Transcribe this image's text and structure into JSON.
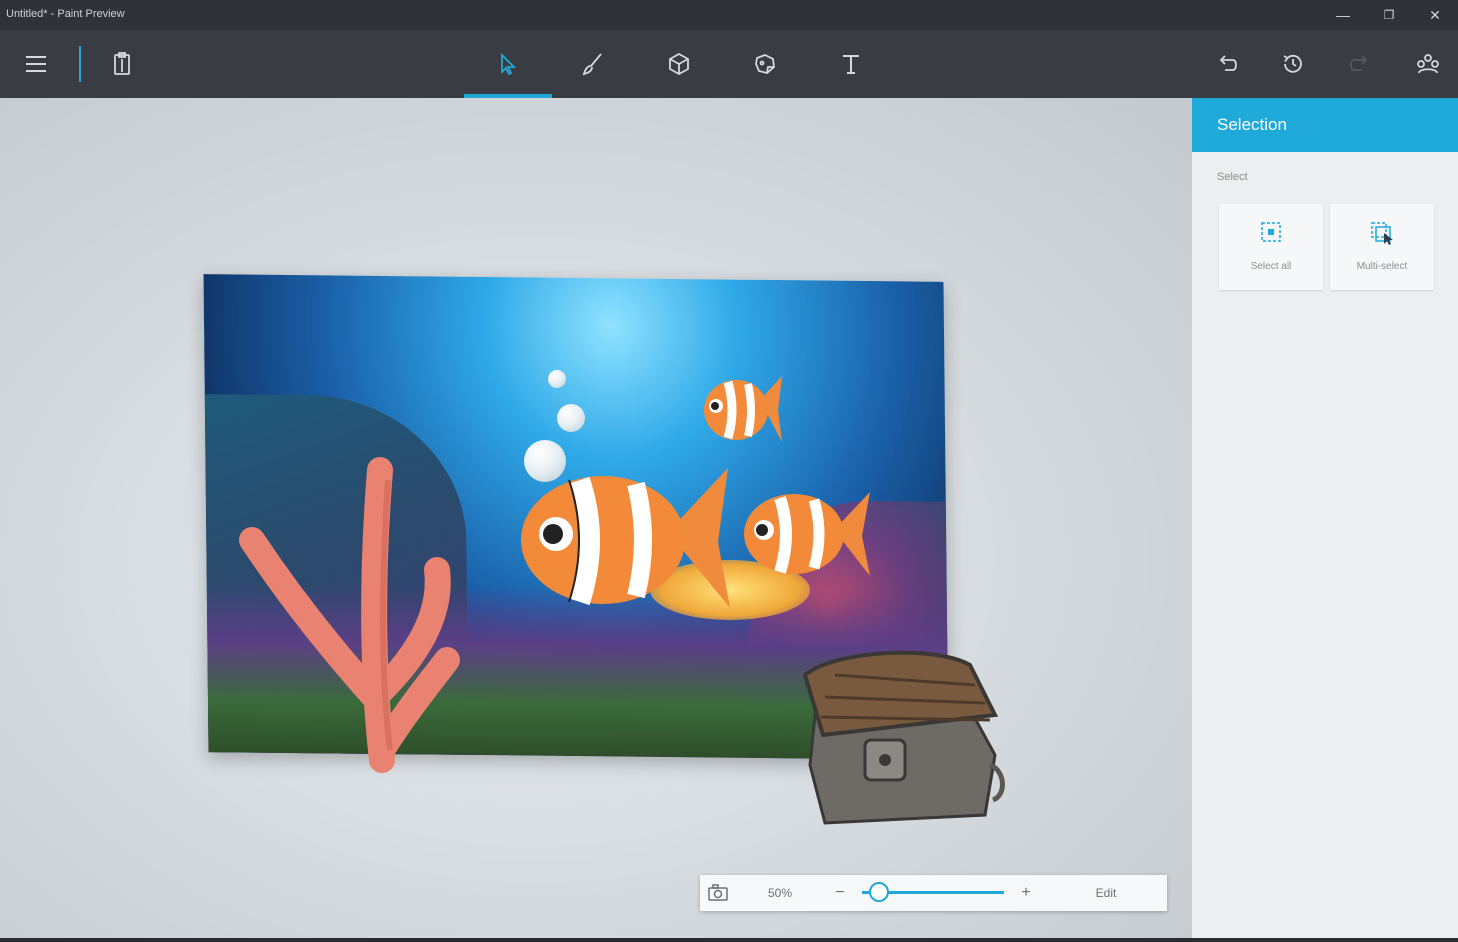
{
  "window": {
    "title": "Untitled* - Paint Preview",
    "controls": [
      "minimize-icon",
      "maximize-icon",
      "close-icon"
    ]
  },
  "toolbar": {
    "left": [
      {
        "name": "menu-icon"
      },
      {
        "name": "paste-icon"
      }
    ],
    "tools": [
      {
        "name": "select-tool",
        "icon": "cursor-icon",
        "active": true
      },
      {
        "name": "brush-tool",
        "icon": "brush-icon",
        "active": false
      },
      {
        "name": "3d-objects-tool",
        "icon": "cube-icon",
        "active": false
      },
      {
        "name": "stickers-tool",
        "icon": "sticker-icon",
        "active": false
      },
      {
        "name": "text-tool",
        "icon": "text-icon",
        "active": false
      }
    ],
    "right": [
      {
        "name": "undo-icon"
      },
      {
        "name": "history-icon"
      },
      {
        "name": "redo-icon"
      },
      {
        "name": "community-icon"
      }
    ],
    "accent": "#1fa9d8"
  },
  "panel": {
    "title": "Selection",
    "section_label": "Select",
    "buttons": [
      {
        "label": "Select all",
        "icon": "select-all-icon"
      },
      {
        "label": "Multi-select",
        "icon": "multi-select-icon"
      }
    ]
  },
  "zoom": {
    "zoom_label": "50%",
    "minus": "−",
    "plus": "+",
    "edit_label": "Edit",
    "level": 0.12
  }
}
